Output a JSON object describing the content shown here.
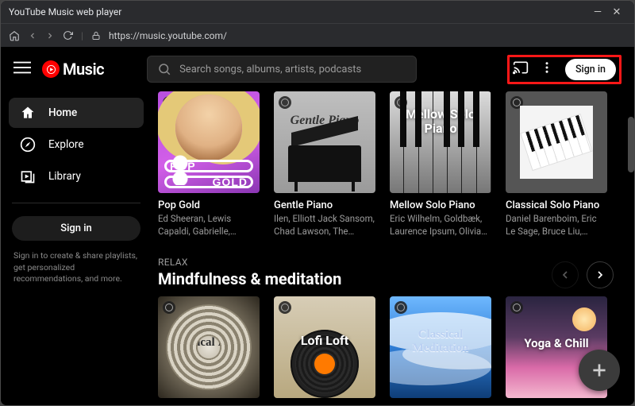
{
  "window": {
    "title": "YouTube Music web player"
  },
  "browser": {
    "url": "https://music.youtube.com/"
  },
  "brand": {
    "name": "Music"
  },
  "search": {
    "placeholder": "Search songs, albums, artists, podcasts"
  },
  "header": {
    "sign_in": "Sign in"
  },
  "sidebar": {
    "items": [
      {
        "label": "Home"
      },
      {
        "label": "Explore"
      },
      {
        "label": "Library"
      }
    ],
    "sign_in": "Sign in",
    "note": "Sign in to create & share playlists, get personalized recommendations, and more."
  },
  "rows": [
    {
      "cards": [
        {
          "title": "Pop Gold",
          "subtitle": "Ed Sheeran, Lewis Capaldi, Gabrielle, Simply Red",
          "overlay_top": "POP",
          "overlay_bottom": "GOLD"
        },
        {
          "title": "Gentle Piano",
          "subtitle": "Ilen, Elliott Jack Sansom, Chad Lawson, The Chillest",
          "overlay": "Gentle Piano"
        },
        {
          "title": "Mellow Solo Piano",
          "subtitle": "Eric Wilhelm, Goldbæk, Laurence Ipsum, Olivia Belli",
          "overlay": "Mellow Solo Piano"
        },
        {
          "title": "Classical Solo Piano",
          "subtitle": "Daniel Barenboim, Eric Le Sage, Bruce Liu, Martha..."
        }
      ]
    },
    {
      "eyebrow": "RELAX",
      "headline": "Mindfulness & meditation",
      "cards": [
        {
          "overlay": "Classical Focus"
        },
        {
          "overlay": "Lofi Loft"
        },
        {
          "overlay": "Classical Meditation"
        },
        {
          "overlay": "Yoga & Chill"
        }
      ]
    }
  ]
}
